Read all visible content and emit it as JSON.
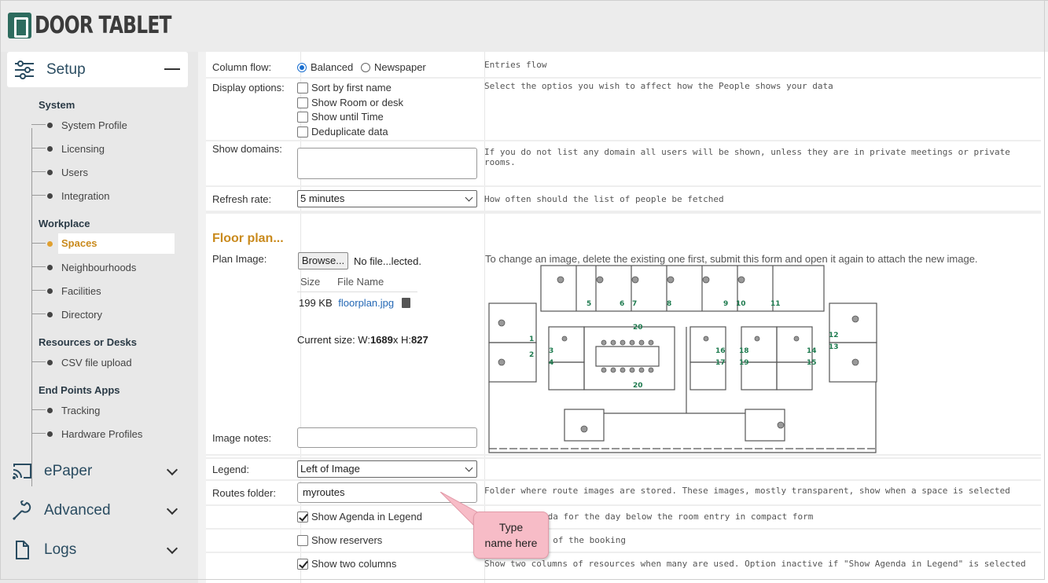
{
  "brand": {
    "name": "DOOR TABLET"
  },
  "sidebar": {
    "setup": {
      "label": "Setup"
    },
    "groups": {
      "system": "System",
      "workplace": "Workplace",
      "resources": "Resources or Desks",
      "endpoints": "End Points Apps"
    },
    "items": [
      {
        "label": "System Profile"
      },
      {
        "label": "Licensing"
      },
      {
        "label": "Users"
      },
      {
        "label": "Integration"
      },
      {
        "label": "Spaces"
      },
      {
        "label": "Neighbourhoods"
      },
      {
        "label": "Facilities"
      },
      {
        "label": "Directory"
      },
      {
        "label": "CSV file upload"
      },
      {
        "label": "Tracking"
      },
      {
        "label": "Hardware Profiles"
      }
    ],
    "active_item": "Spaces",
    "collapsed": [
      {
        "label": "ePaper",
        "icon": "cast-icon"
      },
      {
        "label": "Advanced",
        "icon": "wrench-icon"
      },
      {
        "label": "Logs",
        "icon": "file-icon"
      }
    ]
  },
  "form": {
    "column_flow": {
      "label": "Column flow:",
      "options": [
        "Balanced",
        "Newspaper"
      ],
      "selected": "Balanced",
      "help": "Entries flow"
    },
    "display_options": {
      "label": "Display options:",
      "options": [
        {
          "label": "Sort by first name",
          "checked": false
        },
        {
          "label": "Show Room or desk",
          "checked": false
        },
        {
          "label": "Show until Time",
          "checked": false
        },
        {
          "label": "Deduplicate data",
          "checked": false
        }
      ],
      "help": "Select the optios you wish to affect how the People shows your data"
    },
    "show_domains": {
      "label": "Show domains:",
      "value": "",
      "help": "If you do not list any domain all users will be shown, unless they are in private meetings or private rooms."
    },
    "refresh_rate": {
      "label": "Refresh rate:",
      "value": "5 minutes",
      "help": "How often should the list of people be fetched"
    },
    "floor_plan": {
      "title": "Floor plan...",
      "plan_image_label": "Plan Image:",
      "browse_label": "Browse...",
      "no_file": "No file...lected.",
      "col_size": "Size",
      "col_name": "File Name",
      "file_size": "199 KB",
      "file_name": "floorplan.jpg",
      "current_size_prefix": "Current size: W:",
      "width": "1689",
      "height_prefix": "x H:",
      "height": "827",
      "help": "To change an image, delete the existing one first, submit this form and open it again to attach the new image.",
      "room_numbers": [
        "1",
        "2",
        "3",
        "4",
        "5",
        "6",
        "7",
        "8",
        "9",
        "10",
        "11",
        "12",
        "13",
        "14",
        "15",
        "16",
        "17",
        "18",
        "19",
        "20",
        "20"
      ]
    },
    "image_notes": {
      "label": "Image notes:",
      "value": ""
    },
    "legend": {
      "label": "Legend:",
      "value": "Left of Image"
    },
    "routes_folder": {
      "label": "Routes folder:",
      "value": "myroutes",
      "help": "Folder where route images are stored. These images, mostly transparent, show when a space is selected"
    },
    "show_agenda": {
      "label": "Show Agenda in Legend",
      "checked": true,
      "help": "nda for the day below the room entry in compact form"
    },
    "show_reservers": {
      "label": "Show reservers",
      "checked": false,
      "help": "s of the booking"
    },
    "show_two_columns": {
      "label": "Show two columns",
      "checked": true,
      "help": "Show two columns of resources when many are used. Option inactive if \"Show Agenda in Legend\" is selected"
    }
  },
  "callout": {
    "line1": "Type",
    "line2": "name here"
  },
  "colors": {
    "accent": "#c98a1d",
    "brand": "#2d6b5e",
    "callout": "#f7bcc7",
    "link": "#2468b5"
  }
}
